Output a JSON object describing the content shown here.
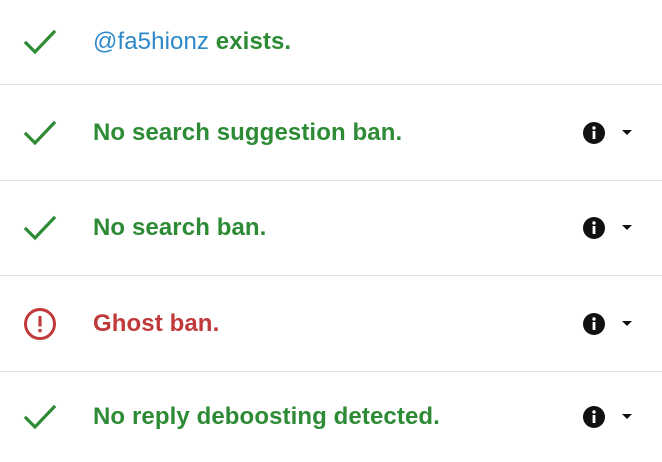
{
  "colors": {
    "success": "#2e8b35",
    "warning": "#c0393b",
    "handle": "#2d88c8",
    "icon": "#111111",
    "divider": "#e3e3e3"
  },
  "results": [
    {
      "status": "success",
      "status_icon": "check-icon",
      "handle": "@fa5hionz",
      "text": " exists.",
      "has_details": false
    },
    {
      "status": "success",
      "status_icon": "check-icon",
      "text": "No search suggestion ban.",
      "has_details": true,
      "details_icons": [
        "info-icon",
        "caret-down-icon"
      ]
    },
    {
      "status": "success",
      "status_icon": "check-icon",
      "text": "No search ban.",
      "has_details": true,
      "details_icons": [
        "info-icon",
        "caret-down-icon"
      ]
    },
    {
      "status": "warning",
      "status_icon": "exclamation-circle-icon",
      "text": "Ghost ban.",
      "has_details": true,
      "details_icons": [
        "info-icon",
        "caret-down-icon"
      ]
    },
    {
      "status": "success",
      "status_icon": "check-icon",
      "text": "No reply deboosting detected.",
      "has_details": true,
      "details_icons": [
        "info-icon",
        "caret-down-icon"
      ]
    }
  ]
}
